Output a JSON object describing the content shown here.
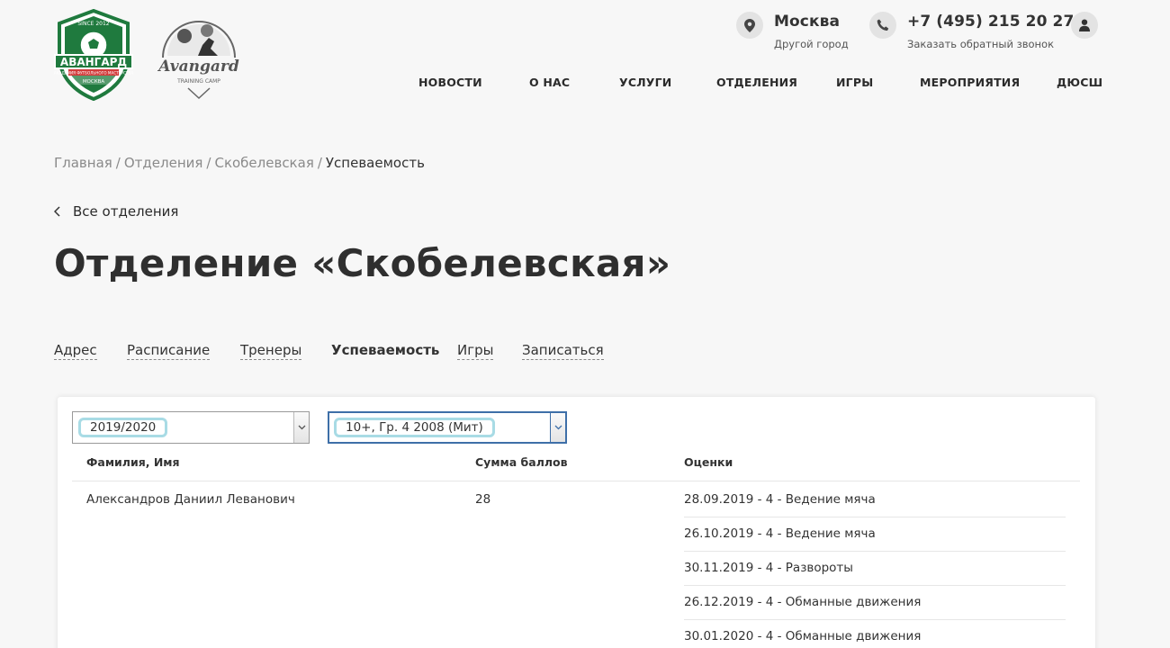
{
  "logos": {
    "avangard_text": "АВАНГАРД",
    "avangard_since": "SINCE 2012",
    "avangard_ribbon": "АКАДЕМИЯ ФУТБОЛЬНОГО МАСТЕРСТВА",
    "avangard_city": "МОСКВА",
    "camp_script": "Avangard",
    "camp_sub": "TRAINING CAMP"
  },
  "header": {
    "city": "Москва",
    "city_sub": "Другой город",
    "phone": "+7 (495) 215 20 27",
    "phone_sub": "Заказать обратный звонок",
    "icons": {
      "city": "location-pin-icon",
      "phone": "phone-icon",
      "user": "user-icon"
    }
  },
  "nav": [
    "НОВОСТИ",
    "О НАС",
    "УСЛУГИ",
    "ОТДЕЛЕНИЯ",
    "ИГРЫ",
    "МЕРОПРИЯТИЯ",
    "ДЮСШ"
  ],
  "breadcrumb": [
    "Главная",
    "Отделения",
    "Скобелевская",
    "Успеваемость"
  ],
  "breadcrumb_sep": "/",
  "back_link": "Все отделения",
  "page_title": "Отделение «Скобелевская»",
  "tabs": [
    "Адрес",
    "Расписание",
    "Тренеры",
    "Успеваемость",
    "Игры",
    "Записаться"
  ],
  "filters": {
    "season": "2019/2020",
    "group": "10+, Гр. 4 2008 (Мит)"
  },
  "table": {
    "columns": [
      "Фамилия, Имя",
      "Сумма баллов",
      "Оценки"
    ],
    "rows": [
      {
        "name": "Александров Даниил Леванович",
        "score": "28",
        "grades": [
          "28.09.2019 - 4 - Ведение мяча",
          "26.10.2019 - 4 - Ведение мяча",
          "30.11.2019 - 4 - Развороты",
          "26.12.2019 - 4 - Обманные движения",
          "30.01.2020 - 4 - Обманные движения"
        ]
      }
    ]
  },
  "colors": {
    "accent_green": "#1f7a3e",
    "focus_border": "#3e6fa8",
    "highlight": "#a8dbe5",
    "background": "#f7f7f7"
  }
}
